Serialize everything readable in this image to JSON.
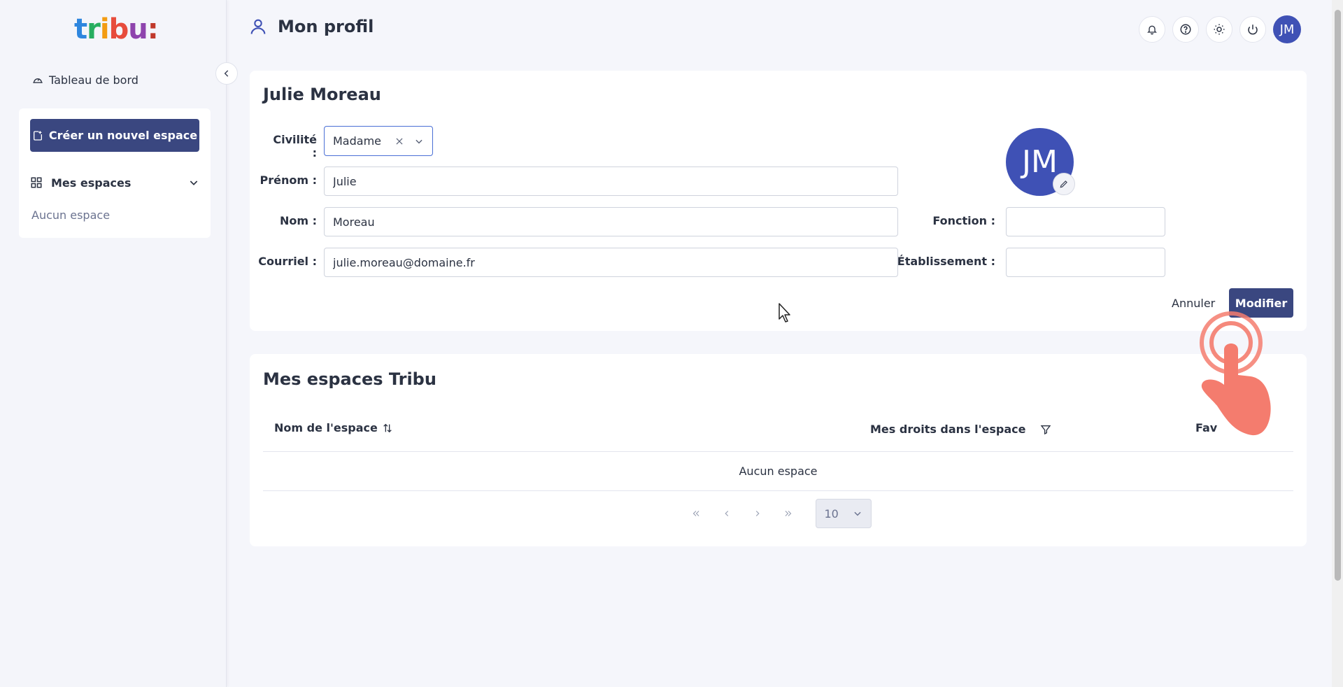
{
  "app": {
    "logo": "tribu:"
  },
  "sidebar": {
    "dashboard": "Tableau de bord",
    "create_space": "Créer un nouvel espace",
    "my_spaces": "Mes espaces",
    "no_space": "Aucun espace"
  },
  "header": {
    "title": "Mon profil",
    "user_initials": "JM"
  },
  "profile": {
    "full_name": "Julie Moreau",
    "initials": "JM",
    "civility": {
      "label": "Civilité :",
      "value": "Madame"
    },
    "firstname": {
      "label": "Prénom :",
      "value": "Julie"
    },
    "lastname": {
      "label": "Nom :",
      "value": "Moreau"
    },
    "email": {
      "label": "Courriel :",
      "value": "julie.moreau@domaine.fr"
    },
    "function": {
      "label": "Fonction :",
      "value": ""
    },
    "establishment": {
      "label": "Établissement :",
      "value": ""
    },
    "cancel": "Annuler",
    "modify": "Modifier"
  },
  "spaces": {
    "title": "Mes espaces Tribu",
    "columns": [
      "Nom de l'espace",
      "Mes droits dans l'espace",
      "Fav"
    ],
    "empty": "Aucun espace",
    "page_size": "10"
  },
  "colors": {
    "primary": "#3a4780",
    "avatar": "#3f51b5",
    "touch": "#f47c6e"
  }
}
